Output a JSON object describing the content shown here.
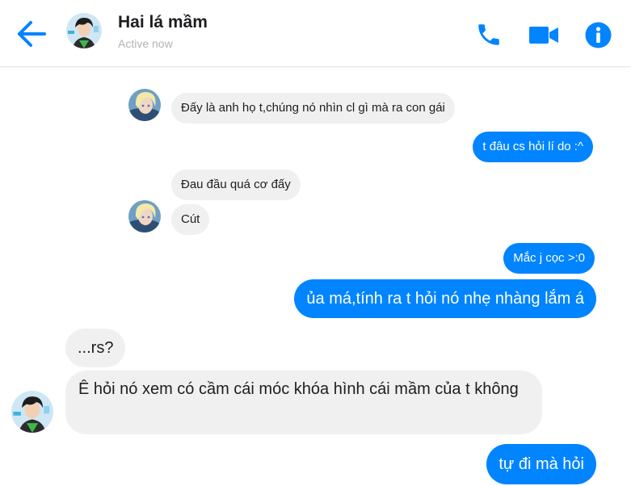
{
  "header": {
    "contact_name": "Hai lá mầm",
    "status": "Active now",
    "accent_color": "#0084ff"
  },
  "icons": {
    "back": "arrow-left-icon",
    "call": "phone-icon",
    "video": "video-camera-icon",
    "info": "info-icon"
  },
  "messages": [
    {
      "side": "incoming",
      "text": "Đấy là anh họ t,chúng nó nhìn cl gì mà ra con gái"
    },
    {
      "side": "outgoing",
      "text": "t đâu cs hỏi lí do :^"
    },
    {
      "side": "incoming",
      "text": "Đau đầu quá cơ đấy"
    },
    {
      "side": "incoming",
      "text": "Cút"
    },
    {
      "side": "outgoing",
      "text": "Mắc j cọc >:0"
    },
    {
      "side": "outgoing",
      "text": "ủa má,tính ra t hỏi nó nhẹ nhàng lắm á"
    },
    {
      "side": "incoming",
      "text": "...rs?"
    },
    {
      "side": "incoming",
      "text": "Ê hỏi nó xem có cầm cái móc khóa hình cái mầm của t không"
    },
    {
      "side": "outgoing",
      "text": "tự đi mà hỏi"
    }
  ]
}
